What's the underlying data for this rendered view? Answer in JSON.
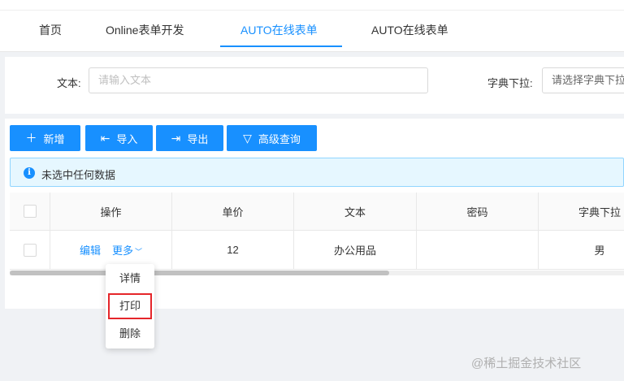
{
  "tabs": [
    {
      "label": "首页",
      "active": false
    },
    {
      "label": "Online表单开发",
      "active": false
    },
    {
      "label": "AUTO在线表单",
      "active": true
    },
    {
      "label": "AUTO在线表单",
      "active": false
    }
  ],
  "search": {
    "text_label": "文本:",
    "text_placeholder": "请输入文本",
    "dict_label": "字典下拉:",
    "dict_placeholder": "请选择字典下拉"
  },
  "toolbar": {
    "add": {
      "icon": "plus-icon",
      "label": "新增"
    },
    "import": {
      "icon": "import-icon",
      "label": "导入"
    },
    "export": {
      "icon": "export-icon",
      "label": "导出"
    },
    "advanced_query": {
      "icon": "filter-icon",
      "label": "高级查询"
    }
  },
  "alert": {
    "icon": "info-icon",
    "text": "未选中任何数据"
  },
  "table": {
    "columns": [
      "操作",
      "单价",
      "文本",
      "密码",
      "字典下拉"
    ],
    "rows": [
      {
        "edit": "编辑",
        "more": "更多",
        "price": "12",
        "text": "办公用品",
        "password": "",
        "dict": "男"
      }
    ]
  },
  "dropdown": {
    "items": [
      "详情",
      "打印",
      "删除"
    ],
    "highlighted": "打印"
  },
  "watermark": "@稀土掘金技术社区",
  "colors": {
    "primary": "#1890ff",
    "highlight_border": "#e5262a",
    "alert_bg": "#e6f7ff"
  }
}
